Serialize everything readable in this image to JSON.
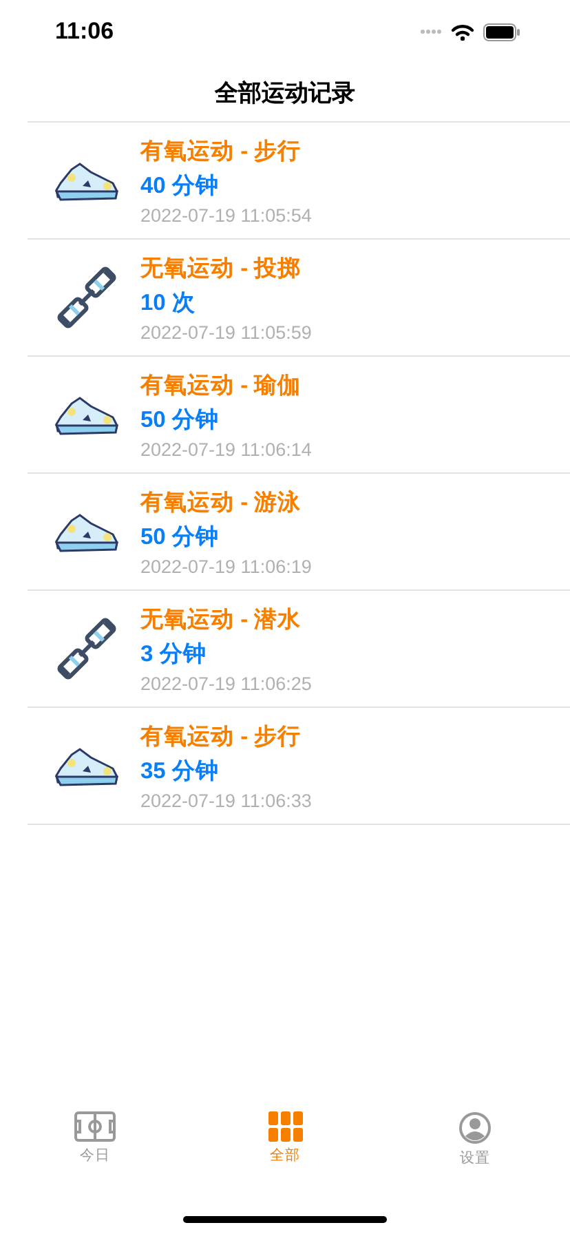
{
  "status_bar": {
    "time": "11:06"
  },
  "title": "全部运动记录",
  "records": [
    {
      "kind": "aerobic",
      "title": "有氧运动 - 步行",
      "amount": "40 分钟",
      "time": "2022-07-19 11:05:54"
    },
    {
      "kind": "anaerobic",
      "title": "无氧运动 - 投掷",
      "amount": "10 次",
      "time": "2022-07-19 11:05:59"
    },
    {
      "kind": "aerobic",
      "title": "有氧运动 - 瑜伽",
      "amount": "50 分钟",
      "time": "2022-07-19 11:06:14"
    },
    {
      "kind": "aerobic",
      "title": "有氧运动 - 游泳",
      "amount": "50 分钟",
      "time": "2022-07-19 11:06:19"
    },
    {
      "kind": "anaerobic",
      "title": "无氧运动 - 潜水",
      "amount": "3 分钟",
      "time": "2022-07-19 11:06:25"
    },
    {
      "kind": "aerobic",
      "title": "有氧运动 - 步行",
      "amount": "35 分钟",
      "time": "2022-07-19 11:06:33"
    }
  ],
  "tabs": [
    {
      "kind": "field",
      "label": "今日",
      "selected": false
    },
    {
      "kind": "grid",
      "label": "全部",
      "selected": true
    },
    {
      "kind": "person",
      "label": "设置",
      "selected": false
    }
  ]
}
